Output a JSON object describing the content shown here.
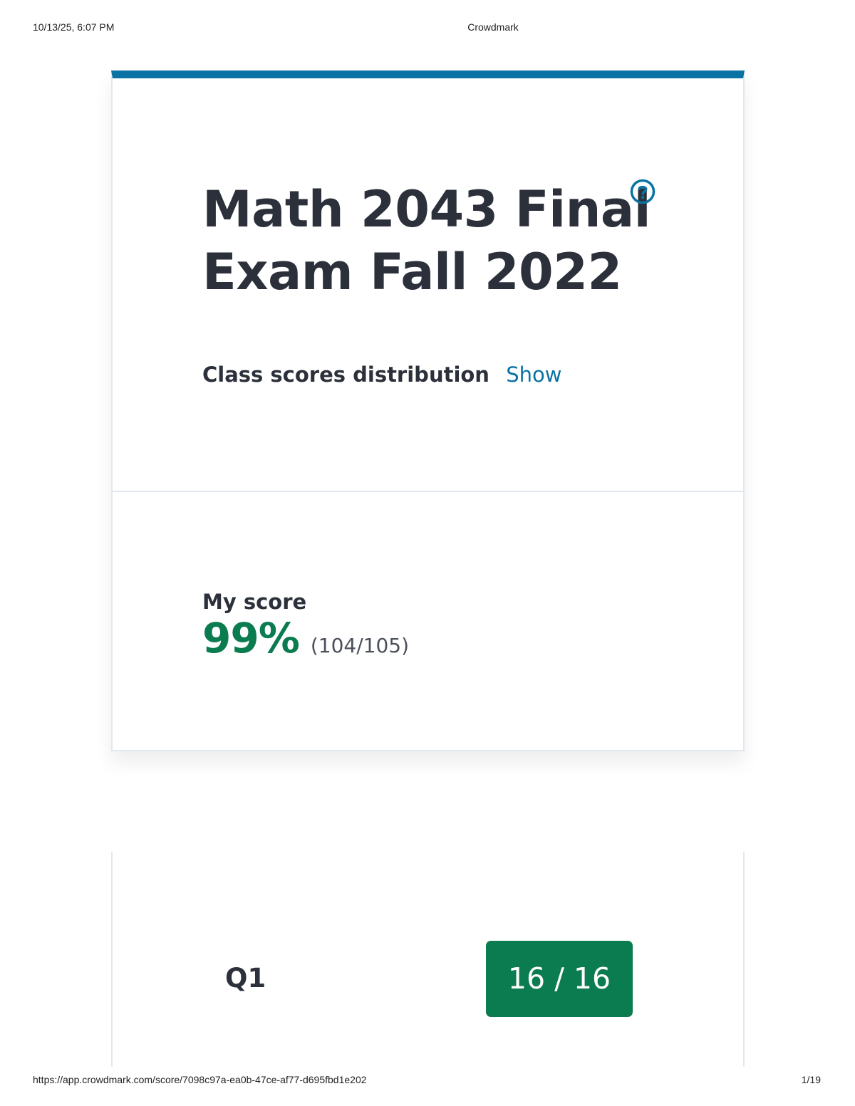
{
  "print": {
    "timestamp": "10/13/25, 6:07 PM",
    "page_title": "Crowdmark",
    "url": "https://app.crowdmark.com/score/7098c97a-ea0b-47ce-af77-d695fbd1e202",
    "page_number": "1/19"
  },
  "exam": {
    "title": "Math 2043 Final Exam Fall 2022",
    "help_icon": "question-circle-icon",
    "distribution_label": "Class scores distribution",
    "distribution_link": "Show"
  },
  "score": {
    "label": "My score",
    "percent": "99%",
    "fraction": "(104/105)"
  },
  "questions": [
    {
      "label": "Q1",
      "score": "16 / 16"
    }
  ],
  "colors": {
    "accent": "#0b73a3",
    "success": "#0a7c4f",
    "text": "#2b303a"
  }
}
